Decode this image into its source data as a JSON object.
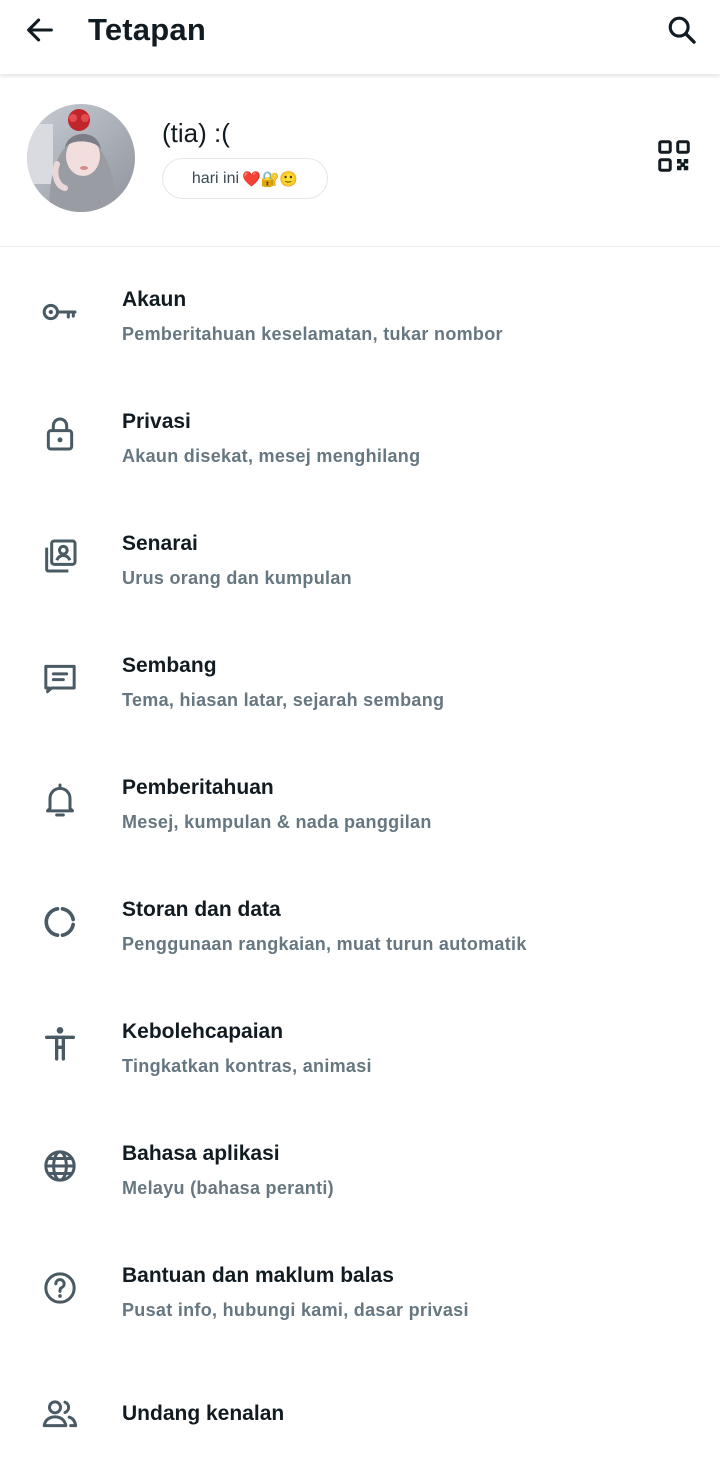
{
  "header": {
    "title": "Tetapan",
    "back_icon": "arrow-left-icon",
    "search_icon": "search-icon"
  },
  "profile": {
    "name": "(tia) :(",
    "status_text": "hari ini",
    "status_emojis": "❤️🔐🙂",
    "qr_icon": "qr-code-icon"
  },
  "settings": [
    {
      "icon": "key-icon",
      "title": "Akaun",
      "subtitle": "Pemberitahuan keselamatan, tukar nombor"
    },
    {
      "icon": "lock-icon",
      "title": "Privasi",
      "subtitle": "Akaun disekat, mesej menghilang"
    },
    {
      "icon": "contacts-list-icon",
      "title": "Senarai",
      "subtitle": "Urus orang dan kumpulan"
    },
    {
      "icon": "chat-icon",
      "title": "Sembang",
      "subtitle": "Tema, hiasan latar, sejarah sembang"
    },
    {
      "icon": "bell-icon",
      "title": "Pemberitahuan",
      "subtitle": "Mesej, kumpulan & nada panggilan"
    },
    {
      "icon": "data-usage-icon",
      "title": "Storan dan data",
      "subtitle": "Penggunaan rangkaian, muat turun automatik"
    },
    {
      "icon": "accessibility-icon",
      "title": "Kebolehcapaian",
      "subtitle": "Tingkatkan kontras, animasi"
    },
    {
      "icon": "globe-icon",
      "title": "Bahasa aplikasi",
      "subtitle": "Melayu (bahasa peranti)"
    },
    {
      "icon": "help-icon",
      "title": "Bantuan dan maklum balas",
      "subtitle": "Pusat info, hubungi kami, dasar privasi"
    },
    {
      "icon": "invite-people-icon",
      "title": "Undang kenalan"
    }
  ],
  "colors": {
    "text_primary": "#111b21",
    "text_secondary": "#667781",
    "icon": "#4a5a64"
  }
}
